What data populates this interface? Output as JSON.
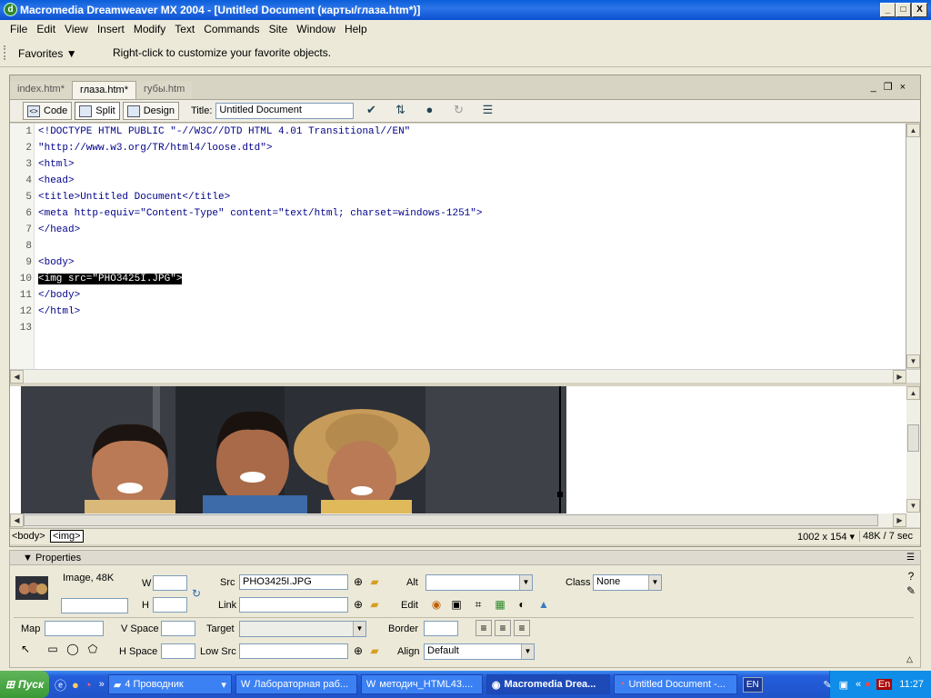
{
  "window": {
    "title": "Macromedia Dreamweaver MX 2004 - [Untitled Document (карты/глаза.htm*)]",
    "min": "_",
    "max": "□",
    "close": "X"
  },
  "menu": [
    "File",
    "Edit",
    "View",
    "Insert",
    "Modify",
    "Text",
    "Commands",
    "Site",
    "Window",
    "Help"
  ],
  "favorites": {
    "label": "Favorites",
    "hint": "Right-click to customize your favorite objects."
  },
  "tabs": [
    "index.htm*",
    "глаза.htm*",
    "губы.htm"
  ],
  "toolbar": {
    "code": "Code",
    "split": "Split",
    "design": "Design",
    "title_label": "Title:",
    "title_value": "Untitled Document"
  },
  "code_lines": [
    {
      "n": "1",
      "text": "<!DOCTYPE HTML PUBLIC \"-//W3C//DTD HTML 4.01 Transitional//EN\""
    },
    {
      "n": "2",
      "text": "\"http://www.w3.org/TR/html4/loose.dtd\">"
    },
    {
      "n": "3",
      "text": "<html>"
    },
    {
      "n": "4",
      "text": "<head>"
    },
    {
      "n": "5",
      "text": "<title>Untitled Document</title>"
    },
    {
      "n": "6",
      "text": "<meta http-equiv=\"Content-Type\" content=\"text/html; charset=windows-1251\">"
    },
    {
      "n": "7",
      "text": "</head>"
    },
    {
      "n": "8",
      "text": ""
    },
    {
      "n": "9",
      "text": "<body>"
    },
    {
      "n": "10",
      "text": "<img src=\"PHO3425I.JPG\">"
    },
    {
      "n": "11",
      "text": "</body>"
    },
    {
      "n": "12",
      "text": "</html>"
    },
    {
      "n": "13",
      "text": ""
    }
  ],
  "status": {
    "tag_body": "<body>",
    "tag_img": "<img>",
    "size": "1002 x 154",
    "weight": "48K / 7 sec"
  },
  "properties": {
    "header": "Properties",
    "image_label": "Image, 48K",
    "w_label": "W",
    "h_label": "H",
    "src_label": "Src",
    "src_value": "PHO3425I.JPG",
    "link_label": "Link",
    "alt_label": "Alt",
    "edit_label": "Edit",
    "class_label": "Class",
    "class_value": "None",
    "map_label": "Map",
    "vspace_label": "V Space",
    "hspace_label": "H Space",
    "target_label": "Target",
    "lowsrc_label": "Low Src",
    "border_label": "Border",
    "align_label": "Align",
    "align_value": "Default"
  },
  "taskbar": {
    "start": "Пуск",
    "items": [
      "4 Проводник",
      "Лабораторная раб...",
      "методич_HTML43....",
      "Macromedia Drea...",
      "Untitled Document -..."
    ],
    "lang": "EN",
    "clock": "11:27"
  }
}
